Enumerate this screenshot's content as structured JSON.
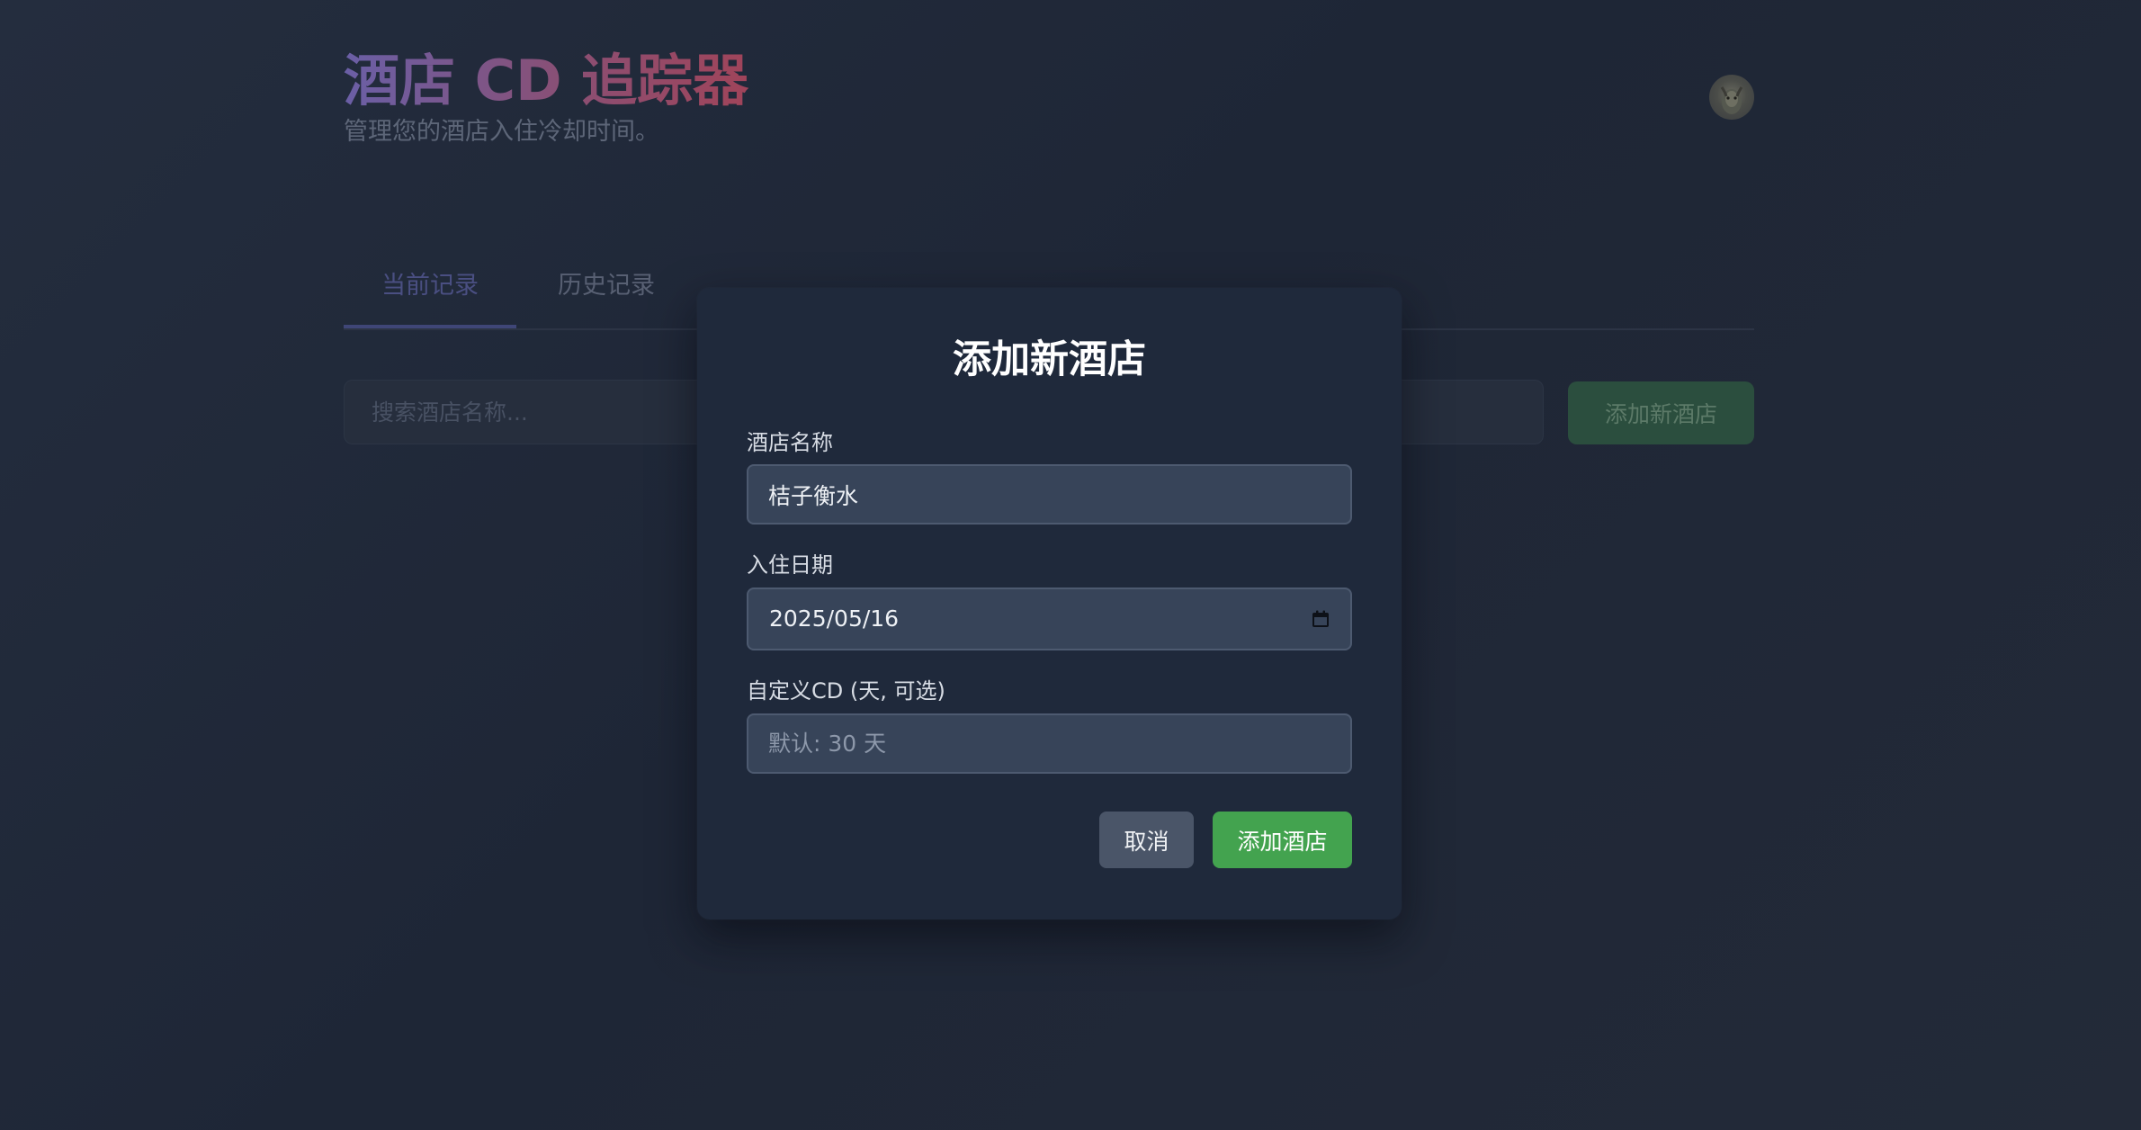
{
  "header": {
    "title": "酒店 CD 追踪器",
    "subtitle": "管理您的酒店入住冷却时间。"
  },
  "tabs": [
    {
      "label": "当前记录",
      "active": true
    },
    {
      "label": "历史记录",
      "active": false
    }
  ],
  "toolbar": {
    "search_placeholder": "搜索酒店名称...",
    "add_button_label": "添加新酒店"
  },
  "modal": {
    "title": "添加新酒店",
    "fields": {
      "hotel_name": {
        "label": "酒店名称",
        "value": "桔子衡水"
      },
      "checkin_date": {
        "label": "入住日期",
        "value": "2025/05/16",
        "icon": "calendar-icon"
      },
      "custom_cd": {
        "label": "自定义CD (天, 可选)",
        "placeholder": "默认: 30 天",
        "value": ""
      }
    },
    "buttons": {
      "cancel_label": "取消",
      "submit_label": "添加酒店"
    }
  },
  "colors": {
    "background": "#222a3a",
    "modal_background": "#1f293b",
    "input_background": "#374459",
    "submit_button": "#43a34f",
    "cancel_button": "#4a5568",
    "title_gradient_start": "#6a5fa6",
    "title_gradient_end": "#a0445a"
  }
}
